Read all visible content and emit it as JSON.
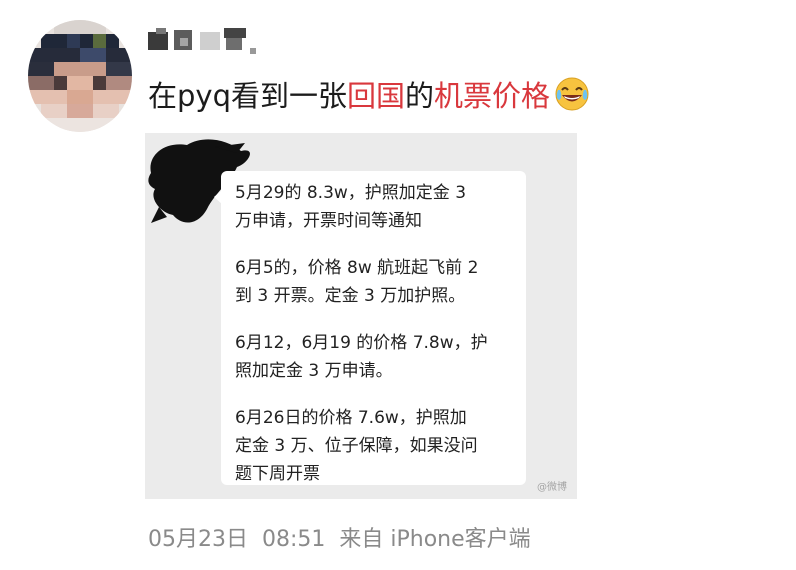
{
  "user": {
    "name": "",
    "avatar_icon": "pixelated-avatar-icon"
  },
  "post": {
    "text_parts": [
      {
        "text": "在pyq看到一张",
        "highlight": false
      },
      {
        "text": "回国",
        "highlight": true
      },
      {
        "text": "的",
        "highlight": false
      },
      {
        "text": "机票价格",
        "highlight": true
      }
    ],
    "emoji_icon": "laughing-tears-emoji-icon",
    "highlight_color": "#d9383d"
  },
  "image": {
    "messages": [
      "5月29的 8.3w，护照加定金 3\n万申请，开票时间等通知",
      "6月5的，价格 8w 航班起飞前 2\n到 3 开票。定金 3 万加护照。",
      "6月12，6月19 的价格 7.8w，护\n照加定金 3 万申请。",
      "6月26日的价格 7.6w，护照加\n定金 3 万、位子保障，如果没问\n题下周开票"
    ],
    "watermark": "@微博"
  },
  "meta": {
    "date": "05月23日",
    "time": "08:51",
    "source": "来自 iPhone客户端"
  }
}
